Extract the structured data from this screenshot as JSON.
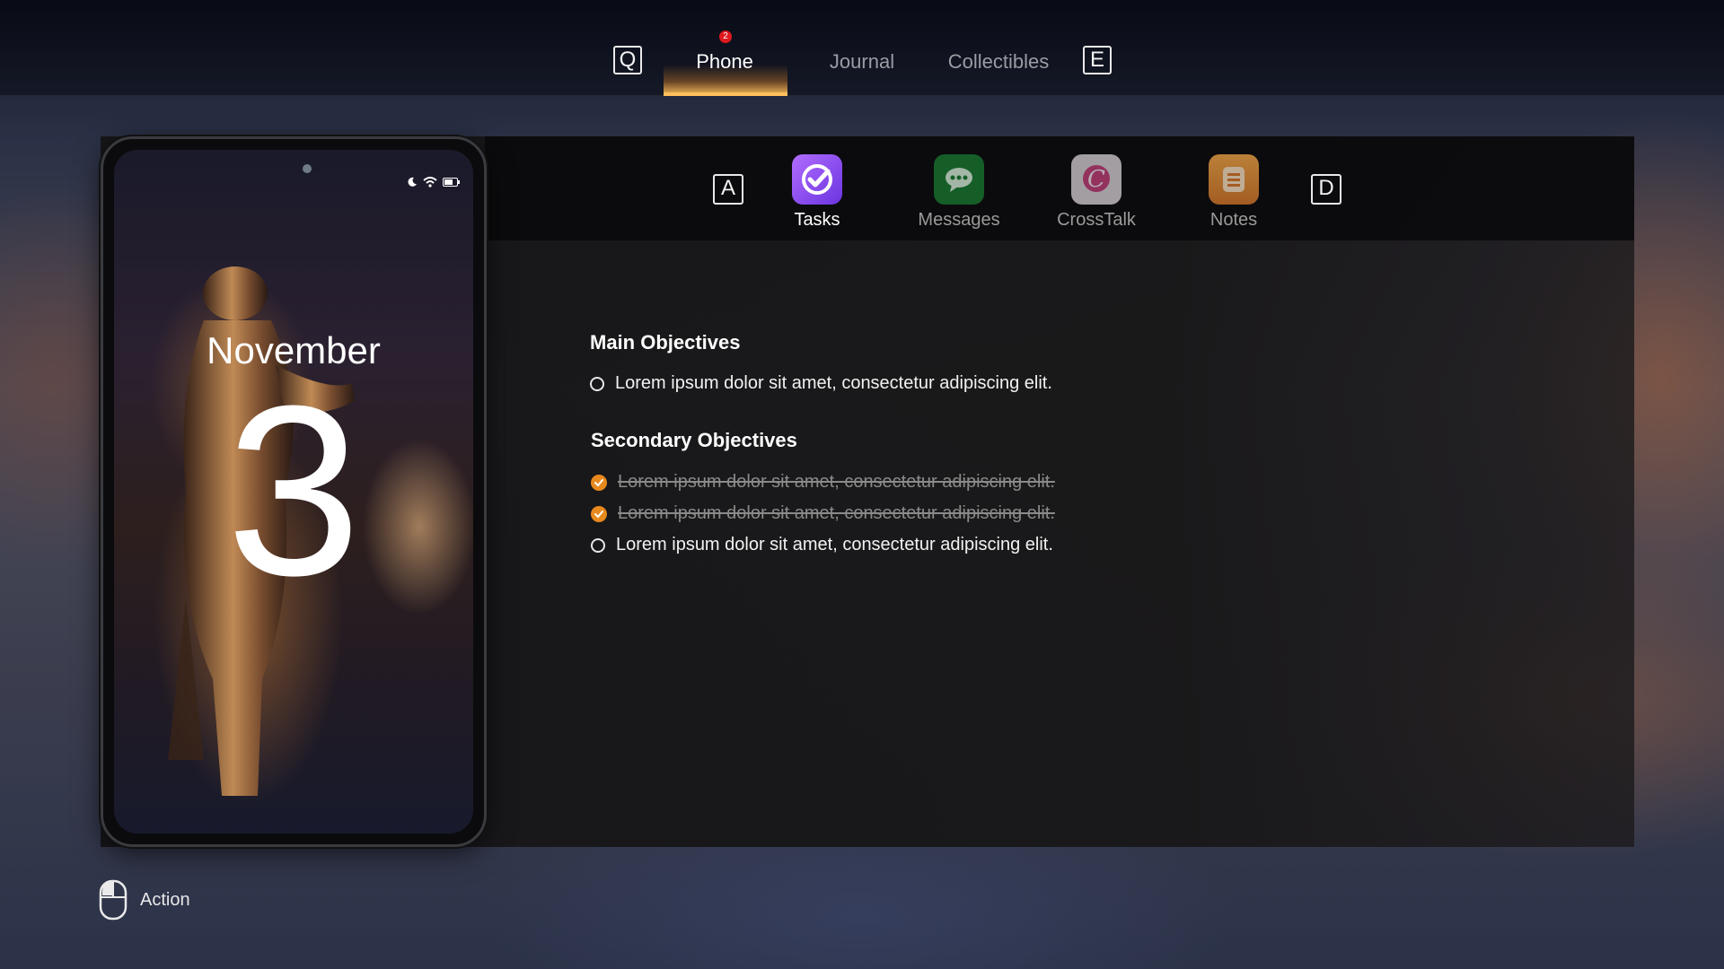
{
  "top_tabs": {
    "left_key": "Q",
    "right_key": "E",
    "tabs": [
      {
        "label": "Phone",
        "active": true,
        "badge": "2"
      },
      {
        "label": "Journal",
        "active": false
      },
      {
        "label": "Collectibles",
        "active": false
      }
    ]
  },
  "apps": {
    "left_key": "A",
    "right_key": "D",
    "items": [
      {
        "label": "Tasks",
        "icon": "tasks-check-icon",
        "color": "#8a4cf0",
        "active": true
      },
      {
        "label": "Messages",
        "icon": "chat-bubble-icon",
        "color": "#1e9a3a",
        "active": false
      },
      {
        "label": "CrossTalk",
        "icon": "crosstalk-logo-icon",
        "color": "#d9d4d6",
        "active": false
      },
      {
        "label": "Notes",
        "icon": "notes-icon",
        "color": "#f09a3a",
        "active": false
      }
    ]
  },
  "phone": {
    "month": "November",
    "day": "3",
    "status_icons": [
      "moon-icon",
      "wifi-icon",
      "battery-icon"
    ]
  },
  "objectives": {
    "main_title": "Main Objectives",
    "main": [
      {
        "text": "Lorem ipsum dolor sit amet, consectetur adipiscing elit.",
        "done": false
      }
    ],
    "secondary_title": "Secondary Objectives",
    "secondary": [
      {
        "text": "Lorem ipsum dolor sit amet, consectetur adipiscing elit.",
        "done": true
      },
      {
        "text": "Lorem ipsum dolor sit amet, consectetur adipiscing elit.",
        "done": true
      },
      {
        "text": "Lorem ipsum dolor sit amet, consectetur adipiscing elit.",
        "done": false
      }
    ]
  },
  "prompt": {
    "icon": "mouse-left-click-icon",
    "label": "Action"
  },
  "colors": {
    "accent": "#ffbf5a",
    "check": "#e8891e",
    "badge": "#e0191f"
  }
}
